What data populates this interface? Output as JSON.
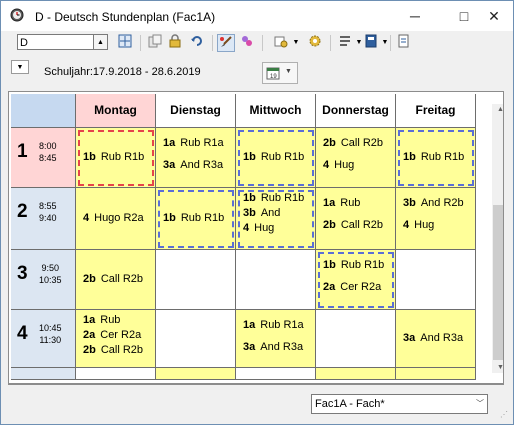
{
  "window": {
    "title": "D - Deutsch  Stundenplan  (Fac1A)"
  },
  "title_controls": {
    "minimize": "─",
    "maximize": "□",
    "close": "✕"
  },
  "toolbar": {
    "class_select_value": "D",
    "icons": [
      "grid-expand-icon",
      "copy-icon",
      "lock-icon",
      "undo-icon",
      "brush-icon",
      "settings-gear-icon",
      "wrench-icon",
      "gear-icon",
      "list-icon",
      "book-icon",
      "export-icon"
    ]
  },
  "subbar": {
    "period_label": "Schuljahr:17.9.2018 - 28.6.2019"
  },
  "timetable": {
    "days": [
      "Montag",
      "Dienstag",
      "Mittwoch",
      "Donnerstag",
      "Freitag"
    ],
    "periods": [
      {
        "num": "1",
        "start": "8:00",
        "end": "8:45"
      },
      {
        "num": "2",
        "start": "8:55",
        "end": "9:40"
      },
      {
        "num": "3",
        "start": "9:50",
        "end": "10:35"
      },
      {
        "num": "4",
        "start": "10:45",
        "end": "11:30"
      }
    ],
    "rows": [
      [
        {
          "lines": [
            {
              "cls": "1b",
              "text": "Rub R1b"
            }
          ]
        },
        {
          "lines": [
            {
              "cls": "1a",
              "text": "Rub R1a"
            },
            {
              "cls": "3a",
              "text": "And R3a"
            }
          ]
        },
        {
          "lines": [
            {
              "cls": "1b",
              "text": "Rub R1b"
            }
          ]
        },
        {
          "lines": [
            {
              "cls": "2b",
              "text": "Call R2b"
            },
            {
              "cls": "4",
              "text": "Hug"
            }
          ]
        },
        {
          "lines": [
            {
              "cls": "1b",
              "text": "Rub R1b"
            }
          ]
        }
      ],
      [
        {
          "lines": [
            {
              "cls": "4",
              "text": "Hugo R2a"
            }
          ]
        },
        {
          "lines": [
            {
              "cls": "1b",
              "text": "Rub R1b"
            }
          ]
        },
        {
          "lines": [
            {
              "cls": "1b",
              "text": "Rub R1b"
            },
            {
              "cls": "3b",
              "text": "And"
            },
            {
              "cls": "4",
              "text": "Hug"
            }
          ]
        },
        {
          "lines": [
            {
              "cls": "1a",
              "text": "Rub"
            },
            {
              "cls": "2b",
              "text": "Call R2b"
            }
          ]
        },
        {
          "lines": [
            {
              "cls": "3b",
              "text": "And R2b"
            },
            {
              "cls": "4",
              "text": "Hug"
            }
          ]
        }
      ],
      [
        {
          "lines": [
            {
              "cls": "2b",
              "text": "Call R2b"
            }
          ]
        },
        {
          "lines": []
        },
        {
          "lines": []
        },
        {
          "lines": [
            {
              "cls": "1b",
              "text": "Rub R1b"
            },
            {
              "cls": "2a",
              "text": "Cer  R2a"
            }
          ]
        },
        {
          "lines": []
        }
      ],
      [
        {
          "lines": [
            {
              "cls": "1a",
              "text": "Rub"
            },
            {
              "cls": "2a",
              "text": "Cer  R2a"
            },
            {
              "cls": "2b",
              "text": "Call R2b"
            }
          ]
        },
        {
          "lines": []
        },
        {
          "lines": [
            {
              "cls": "1a",
              "text": "Rub R1a"
            },
            {
              "cls": "3a",
              "text": "And R3a"
            }
          ]
        },
        {
          "lines": []
        },
        {
          "lines": [
            {
              "cls": "3a",
              "text": "And R3a"
            }
          ]
        }
      ]
    ]
  },
  "status": {
    "format_value": "Fac1A - Fach*"
  },
  "colors": {
    "lesson": "#ffff99",
    "active_day": "#ffd5d5",
    "header_blue": "#c6d9f0",
    "selection_red": "#e6444a",
    "selection_blue": "#5b6fd6"
  }
}
